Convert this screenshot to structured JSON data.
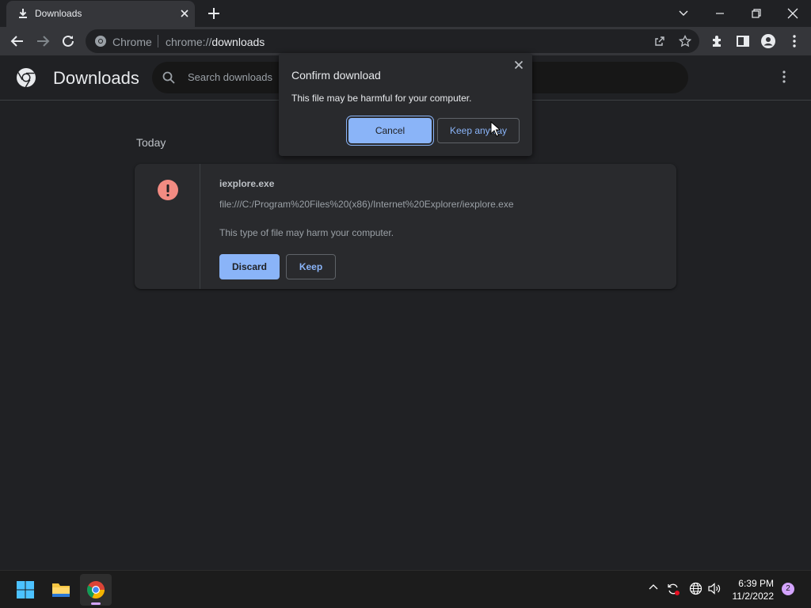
{
  "tab": {
    "title": "Downloads",
    "icon": "download-icon"
  },
  "omnibox": {
    "site_label": "Chrome",
    "url_scheme": "chrome://",
    "url_host": "downloads"
  },
  "page": {
    "title": "Downloads",
    "search_placeholder": "Search downloads"
  },
  "downloads": {
    "section_date": "Today",
    "items": [
      {
        "file_name": "iexplore.exe",
        "url": "file:///C:/Program%20Files%20(x86)/Internet%20Explorer/iexplore.exe",
        "warning": "This type of file may harm your computer.",
        "discard_label": "Discard",
        "keep_label": "Keep"
      }
    ]
  },
  "dialog": {
    "title": "Confirm download",
    "message": "This file may be harmful for your computer.",
    "cancel_label": "Cancel",
    "keep_anyway_label": "Keep anyway"
  },
  "taskbar": {
    "apps": [
      "windows-start-icon",
      "file-explorer-icon",
      "chrome-icon"
    ],
    "time": "6:39 PM",
    "date": "11/2/2022",
    "notification_count": "2"
  },
  "colors": {
    "background": "#202124",
    "surface": "#292a2d",
    "accent": "#8ab4f8",
    "warning": "#f28b82"
  }
}
